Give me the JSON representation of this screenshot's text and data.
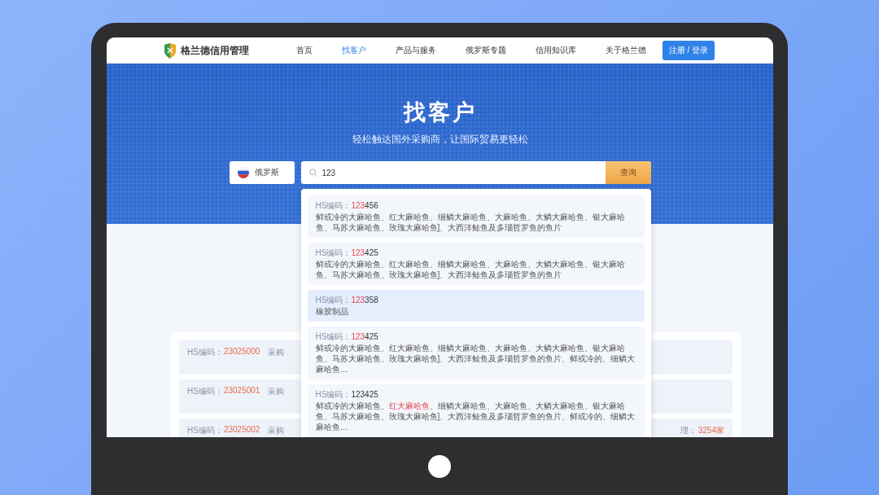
{
  "nav": {
    "logo": "格兰德信用管理",
    "items": [
      {
        "label": "首页",
        "selected": false
      },
      {
        "label": "找客户",
        "selected": true
      },
      {
        "label": "产品与服务",
        "selected": false
      },
      {
        "label": "俄罗斯专题",
        "selected": false
      },
      {
        "label": "信用知识库",
        "selected": false
      },
      {
        "label": "关于格兰德",
        "selected": false
      }
    ],
    "login_button": "注册 / 登录"
  },
  "hero": {
    "title": "找客户",
    "subtitle": "轻松触达国外采购商，让国际贸易更轻松",
    "country": "俄罗斯",
    "search_value": "123",
    "search_button": "查询"
  },
  "suggestions": [
    {
      "label": "HS编码：",
      "selected": false,
      "code_parts": [
        {
          "text": "123",
          "highlight": true
        },
        {
          "text": "456",
          "highlight": false
        }
      ],
      "description_parts": [
        {
          "text": "鲜或冷的大麻哈鱼、红大麻哈鱼、细鳞大麻哈鱼、大麻哈鱼、大鳞大麻哈鱼、银大麻哈鱼、马苏大麻哈鱼、玫瑰大麻哈鱼]、大西洋鲑鱼及多瑙哲罗鱼的鱼片",
          "highlight": false
        }
      ]
    },
    {
      "label": "HS编码：",
      "selected": false,
      "code_parts": [
        {
          "text": "123",
          "highlight": true
        },
        {
          "text": "425",
          "highlight": false
        }
      ],
      "description_parts": [
        {
          "text": "鲜或冷的大麻哈鱼、红大麻哈鱼、细鳞大麻哈鱼、大麻哈鱼、大鳞大麻哈鱼、银大麻哈鱼、马苏大麻哈鱼、玫瑰大麻哈鱼]、大西洋鲑鱼及多瑙哲罗鱼的鱼片",
          "highlight": false
        }
      ]
    },
    {
      "label": "HS编码：",
      "selected": true,
      "code_parts": [
        {
          "text": "123",
          "highlight": true
        },
        {
          "text": "358",
          "highlight": false
        }
      ],
      "description_parts": [
        {
          "text": "橡胶制品",
          "highlight": false
        }
      ]
    },
    {
      "label": "HS编码：",
      "selected": false,
      "code_parts": [
        {
          "text": "123",
          "highlight": true
        },
        {
          "text": "425",
          "highlight": false
        }
      ],
      "description_parts": [
        {
          "text": "鲜或冷的大麻哈鱼、红大麻哈鱼、细鳞大麻哈鱼、大麻哈鱼、大鳞大麻哈鱼、银大麻哈鱼、马苏大麻哈鱼、玫瑰大麻哈鱼]、大西洋鲑鱼及多瑙哲罗鱼的鱼片、鲜或冷的、细鳞大麻哈鱼…",
          "highlight": false
        }
      ]
    },
    {
      "label": "HS编码：",
      "selected": false,
      "code_parts": [
        {
          "text": "123425",
          "highlight": false
        }
      ],
      "description_parts": [
        {
          "text": "鲜或冷的大麻哈鱼、",
          "highlight": false
        },
        {
          "text": "红大麻哈鱼",
          "highlight": true
        },
        {
          "text": "、细鳞大麻哈鱼、大麻哈鱼、大鳞大麻哈鱼、银大麻哈鱼、马苏大麻哈鱼、玫瑰大麻哈鱼]、大西洋鲑鱼及多瑙哲罗鱼的鱼片、鲜或冷的、细鳞大麻哈鱼…",
          "highlight": false
        }
      ]
    }
  ],
  "results": [
    {
      "label": "HS编码：",
      "code": "23025000",
      "column_2": "采购"
    },
    {
      "label": "HS编码：",
      "code": "23025001",
      "column_2": "采购"
    },
    {
      "label": "HS编码：",
      "code": "23025002",
      "column_2": "采购",
      "column_3": "理：",
      "column_4": "3254家"
    }
  ]
}
